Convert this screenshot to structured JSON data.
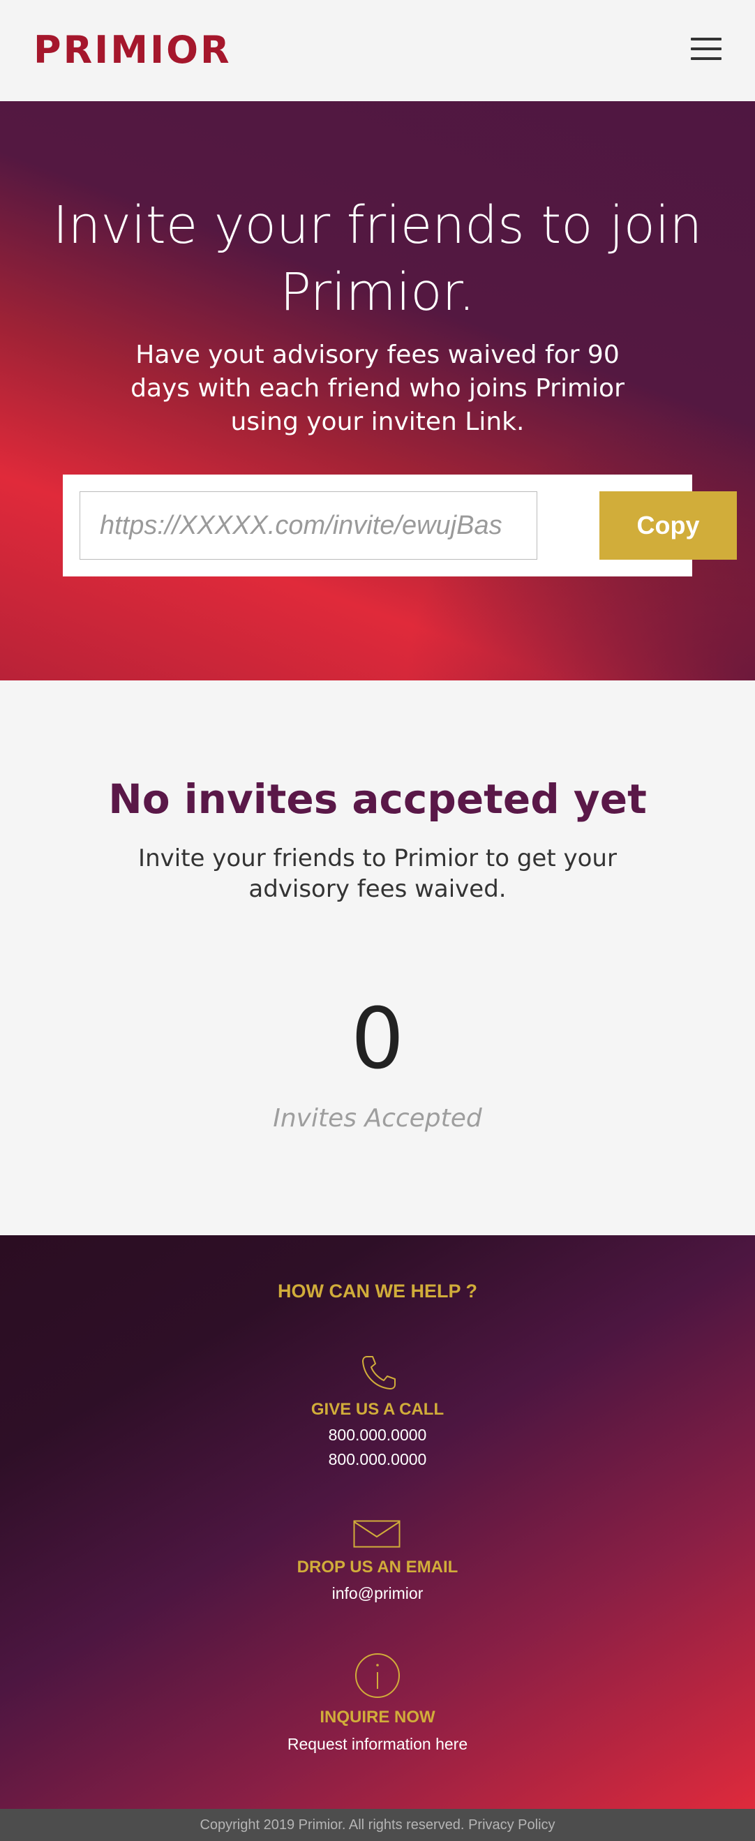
{
  "header": {
    "logo_text": "PRIMIOR",
    "menu_icon": "hamburger-menu-icon",
    "brand_color": "#a5172c"
  },
  "hero": {
    "title": "Invite your friends to join Primior.",
    "subtitle": "Have yout advisory fees waived for 90 days with each friend who joins Primior using your inviten Link.",
    "invite_link_placeholder": "https://XXXXX.com/invite/ewujBas",
    "copy_label": "Copy",
    "accent_color": "#d1ad3a"
  },
  "invites": {
    "title": "No invites accpeted yet",
    "text": "Invite your friends to Primior to get your advisory fees waived.",
    "count": "0",
    "count_label": "Invites Accepted"
  },
  "help": {
    "title": "HOW CAN WE HELP ?",
    "call": {
      "icon": "phone-icon",
      "heading": "GIVE US A CALL",
      "lines": [
        "800.000.0000",
        "800.000.0000"
      ]
    },
    "email": {
      "icon": "envelope-icon",
      "heading": "DROP US AN EMAIL",
      "address": "info@primior"
    },
    "inquire": {
      "icon": "info-icon",
      "heading": "INQUIRE NOW",
      "link_text": "Request information here"
    }
  },
  "footer": {
    "copyright": "Copyright 2019 Primior. All rights reserved.",
    "privacy_label": "Privacy Policy"
  }
}
